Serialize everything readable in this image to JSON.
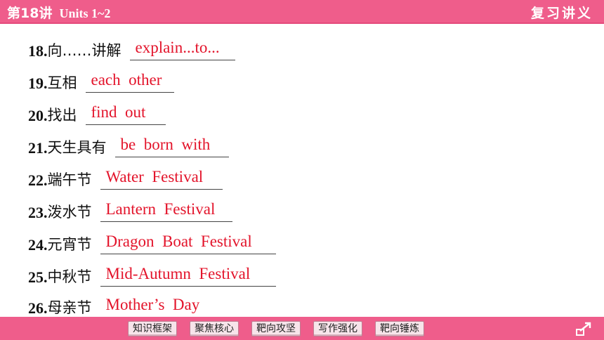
{
  "header": {
    "lesson": "第18讲",
    "units": "Units 1~2",
    "title": "复习讲义"
  },
  "items": [
    {
      "num": "18.",
      "zh": "向……讲解",
      "answer": "explain...to..."
    },
    {
      "num": "19.",
      "zh": "互相",
      "answer": "each  other"
    },
    {
      "num": "20.",
      "zh": "找出",
      "answer": "find  out"
    },
    {
      "num": "21.",
      "zh": "天生具有",
      "answer": "be  born  with"
    },
    {
      "num": "22.",
      "zh": "端午节",
      "answer": "Water  Festival"
    },
    {
      "num": "23.",
      "zh": "泼水节",
      "answer": "Lantern  Festival"
    },
    {
      "num": "24.",
      "zh": "元宵节",
      "answer": "Dragon  Boat  Festival"
    },
    {
      "num": "25.",
      "zh": "中秋节",
      "answer": "Mid-Autumn  Festival"
    },
    {
      "num": "26.",
      "zh": "母亲节",
      "answer": "Mother’s  Day"
    }
  ],
  "nav": [
    "知识框架",
    "聚焦核心",
    "靶向攻坚",
    "写作强化",
    "靶向锤炼"
  ],
  "colors": {
    "accent": "#ef5d8b",
    "answer": "#e3142b"
  },
  "icons": {
    "corner": "return-arrow-icon"
  }
}
